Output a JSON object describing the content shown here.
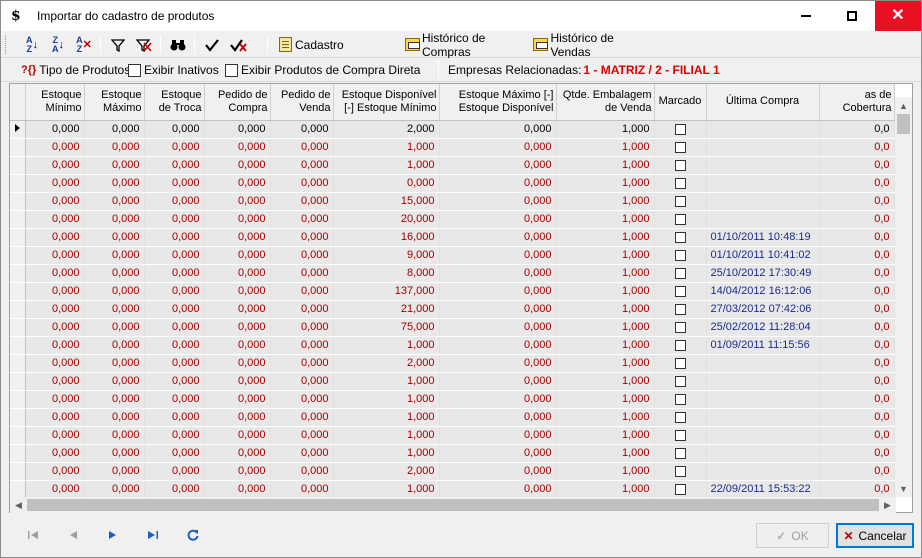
{
  "window": {
    "title": "Importar do cadastro de produtos",
    "app_icon": "$",
    "minimize_glyph": "",
    "close_glyph": "✕"
  },
  "toolbar": {
    "sort_asc_icon": "sort-ascending-icon",
    "sort_desc_icon": "sort-descending-icon",
    "clear_sort_icon": "clear-sort-icon",
    "filter_icon": "filter-icon",
    "clear_filter_icon": "clear-filter-icon",
    "find_icon": "binoculars-icon",
    "check_all_icon": "check-icon",
    "uncheck_all_icon": "uncheck-icon",
    "cadastro_label": "Cadastro",
    "historico_compras_label": "Histórico de Compras",
    "historico_vendas_label": "Histórico de Vendas"
  },
  "filterbar": {
    "tipo_icon_glyph": "?{}",
    "tipo_produtos_label": "Tipo de Produtos",
    "exibir_inativos_label": "Exibir Inativos",
    "exibir_compra_direta_label": "Exibir Produtos de Compra Direta",
    "empresas_label": "Empresas Relacionadas:",
    "empresas_value": "1 - MATRIZ / 2 - FILIAL 1"
  },
  "grid": {
    "columns": [
      "Estoque\nMínimo",
      "Estoque\nMáximo",
      "Estoque\nde Troca",
      "Pedido de\nCompra",
      "Pedido de\nVenda",
      "Estoque Disponível\n[-] Estoque Mínimo",
      "Estoque Máximo [-]\nEstoque Disponível",
      "Qtde. Embalagem\nde Venda",
      "Marcado",
      "Última Compra",
      "as de Cobertura"
    ],
    "rows": [
      {
        "v": [
          "0,000",
          "0,000",
          "0,000",
          "0,000",
          "0,000",
          "2,000",
          "0,000",
          "1,000"
        ],
        "date": "",
        "cob": "0,0"
      },
      {
        "v": [
          "0,000",
          "0,000",
          "0,000",
          "0,000",
          "0,000",
          "1,000",
          "0,000",
          "1,000"
        ],
        "date": "",
        "cob": "0,0"
      },
      {
        "v": [
          "0,000",
          "0,000",
          "0,000",
          "0,000",
          "0,000",
          "1,000",
          "0,000",
          "1,000"
        ],
        "date": "",
        "cob": "0,0"
      },
      {
        "v": [
          "0,000",
          "0,000",
          "0,000",
          "0,000",
          "0,000",
          "0,000",
          "0,000",
          "1,000"
        ],
        "date": "",
        "cob": "0,0"
      },
      {
        "v": [
          "0,000",
          "0,000",
          "0,000",
          "0,000",
          "0,000",
          "15,000",
          "0,000",
          "1,000"
        ],
        "date": "",
        "cob": "0,0"
      },
      {
        "v": [
          "0,000",
          "0,000",
          "0,000",
          "0,000",
          "0,000",
          "20,000",
          "0,000",
          "1,000"
        ],
        "date": "",
        "cob": "0,0"
      },
      {
        "v": [
          "0,000",
          "0,000",
          "0,000",
          "0,000",
          "0,000",
          "16,000",
          "0,000",
          "1,000"
        ],
        "date": "01/10/2011 10:48:19",
        "cob": "0,0"
      },
      {
        "v": [
          "0,000",
          "0,000",
          "0,000",
          "0,000",
          "0,000",
          "9,000",
          "0,000",
          "1,000"
        ],
        "date": "01/10/2011 10:41:02",
        "cob": "0,0"
      },
      {
        "v": [
          "0,000",
          "0,000",
          "0,000",
          "0,000",
          "0,000",
          "8,000",
          "0,000",
          "1,000"
        ],
        "date": "25/10/2012 17:30:49",
        "cob": "0,0"
      },
      {
        "v": [
          "0,000",
          "0,000",
          "0,000",
          "0,000",
          "0,000",
          "137,000",
          "0,000",
          "1,000"
        ],
        "date": "14/04/2012 16:12:06",
        "cob": "0,0"
      },
      {
        "v": [
          "0,000",
          "0,000",
          "0,000",
          "0,000",
          "0,000",
          "21,000",
          "0,000",
          "1,000"
        ],
        "date": "27/03/2012 07:42:06",
        "cob": "0,0"
      },
      {
        "v": [
          "0,000",
          "0,000",
          "0,000",
          "0,000",
          "0,000",
          "75,000",
          "0,000",
          "1,000"
        ],
        "date": "25/02/2012 11:28:04",
        "cob": "0,0"
      },
      {
        "v": [
          "0,000",
          "0,000",
          "0,000",
          "0,000",
          "0,000",
          "1,000",
          "0,000",
          "1,000"
        ],
        "date": "01/09/2011 11:15:56",
        "cob": "0,0"
      },
      {
        "v": [
          "0,000",
          "0,000",
          "0,000",
          "0,000",
          "0,000",
          "2,000",
          "0,000",
          "1,000"
        ],
        "date": "",
        "cob": "0,0"
      },
      {
        "v": [
          "0,000",
          "0,000",
          "0,000",
          "0,000",
          "0,000",
          "1,000",
          "0,000",
          "1,000"
        ],
        "date": "",
        "cob": "0,0"
      },
      {
        "v": [
          "0,000",
          "0,000",
          "0,000",
          "0,000",
          "0,000",
          "1,000",
          "0,000",
          "1,000"
        ],
        "date": "",
        "cob": "0,0"
      },
      {
        "v": [
          "0,000",
          "0,000",
          "0,000",
          "0,000",
          "0,000",
          "1,000",
          "0,000",
          "1,000"
        ],
        "date": "",
        "cob": "0,0"
      },
      {
        "v": [
          "0,000",
          "0,000",
          "0,000",
          "0,000",
          "0,000",
          "1,000",
          "0,000",
          "1,000"
        ],
        "date": "",
        "cob": "0,0"
      },
      {
        "v": [
          "0,000",
          "0,000",
          "0,000",
          "0,000",
          "0,000",
          "1,000",
          "0,000",
          "1,000"
        ],
        "date": "",
        "cob": "0,0"
      },
      {
        "v": [
          "0,000",
          "0,000",
          "0,000",
          "0,000",
          "0,000",
          "2,000",
          "0,000",
          "1,000"
        ],
        "date": "",
        "cob": "0,0"
      },
      {
        "v": [
          "0,000",
          "0,000",
          "0,000",
          "0,000",
          "0,000",
          "1,000",
          "0,000",
          "1,000"
        ],
        "date": "22/09/2011 15:53:22",
        "cob": "0,0"
      }
    ]
  },
  "bottombar": {
    "first_icon": "first-record-icon",
    "prev_icon": "prev-record-icon",
    "next_icon": "next-record-icon",
    "last_icon": "last-record-icon",
    "refresh_icon": "refresh-icon",
    "ok_label": "OK",
    "cancel_label": "Cancelar"
  },
  "colors": {
    "numeric_text": "#a00000",
    "date_text": "#1a2a8a",
    "empresas_value": "#e00000",
    "close_button": "#e81123"
  }
}
